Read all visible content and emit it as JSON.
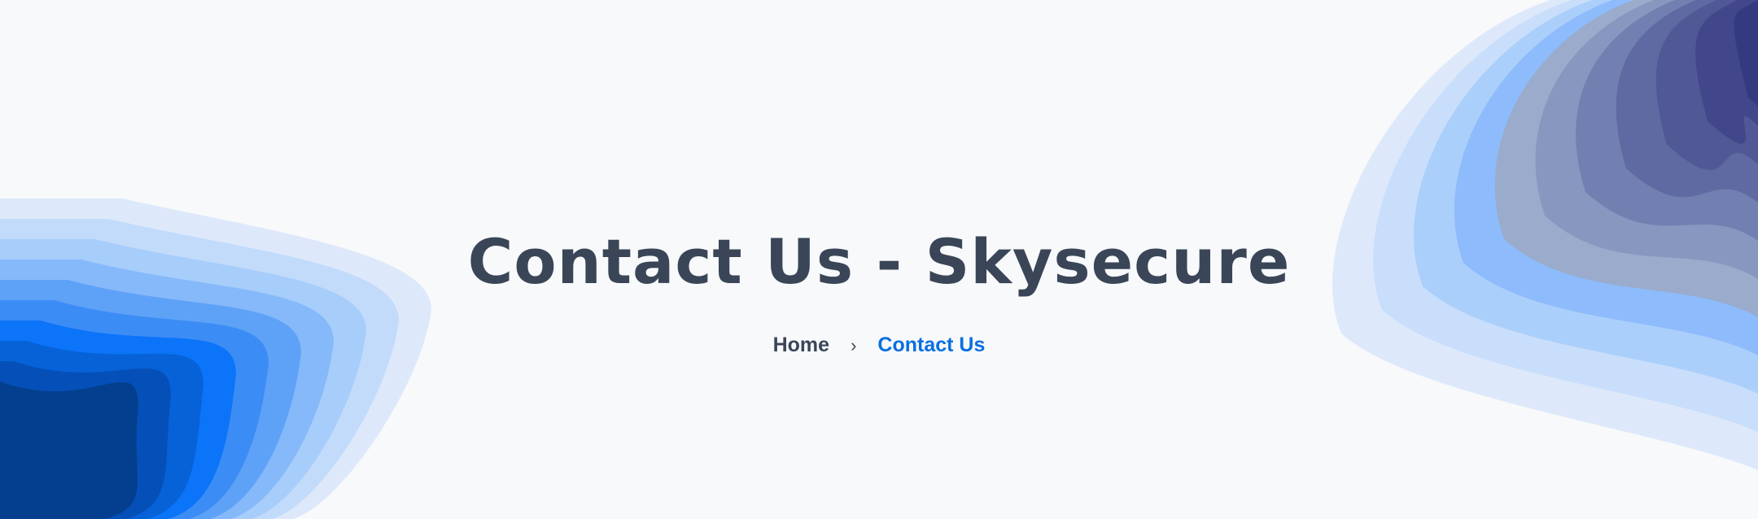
{
  "page": {
    "title": "Contact Us - Skysecure"
  },
  "breadcrumb": {
    "home_label": "Home",
    "separator": "›",
    "current_label": "Contact Us"
  },
  "colors": {
    "background": "#f8f9fa",
    "title": "#3a4658",
    "accent": "#0a6fe0",
    "left_waves": [
      "#dde9fb",
      "#c3dbfb",
      "#a7cdfb",
      "#86b9fa",
      "#5ea2f8",
      "#3c8cf6",
      "#0b74f8",
      "#0762d8",
      "#0550b8",
      "#043f8f"
    ],
    "right_waves": [
      "#dde9fb",
      "#c9defb",
      "#abcffb",
      "#8dbbfb",
      "#9aabcb",
      "#8797bf",
      "#7180b1",
      "#5f6aa3",
      "#515896",
      "#42468a",
      "#333a80"
    ]
  }
}
